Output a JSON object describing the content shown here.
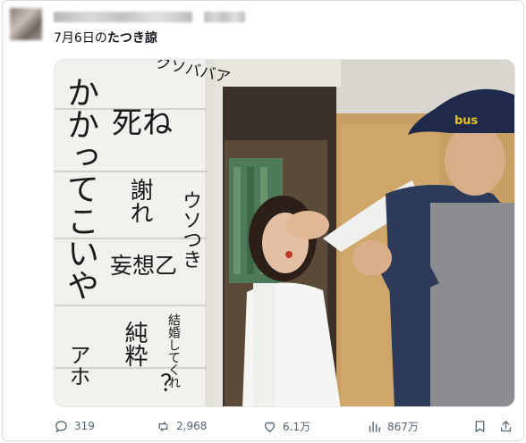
{
  "post": {
    "text_date": "7月6日の",
    "text_bold": "たつき諒"
  },
  "wall_writing": {
    "col1": "かかってこいや",
    "col1b": "アホ",
    "col2a": "クソババア",
    "col2b": "死ね",
    "col2c": "謝れ",
    "col2d": "妄想乙",
    "col2e": "純粋",
    "col3a": "ウソつき",
    "col3b": "結婚してくれ",
    "q": "？"
  },
  "cap_logo": "bus",
  "actions": {
    "reply": {
      "icon": "reply-icon",
      "count": "319"
    },
    "repost": {
      "icon": "repost-icon",
      "count": "2,968"
    },
    "like": {
      "icon": "like-icon",
      "count": "6.1万"
    },
    "views": {
      "icon": "views-icon",
      "count": "867万"
    },
    "bookmark": {
      "icon": "bookmark-icon"
    },
    "share": {
      "icon": "share-icon"
    }
  }
}
